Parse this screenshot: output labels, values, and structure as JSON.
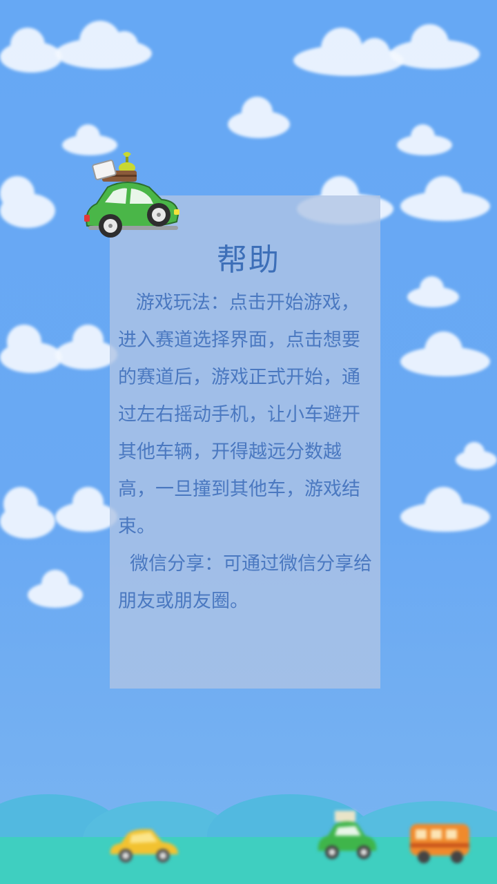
{
  "help": {
    "title": "帮助",
    "paragraph1": "   游戏玩法：点击开始游戏，进入赛道选择界面，点击想要的赛道后，游戏正式开始，通过左右摇动手机，让小车避开其他车辆，开得越远分数越高，一旦撞到其他车，游戏结束。",
    "paragraph2": "  微信分享：可通过微信分享给朋友或朋友圈。"
  },
  "colors": {
    "sky": "#66a8f4",
    "panel": "#b0c4e4",
    "text": "#4a78c0",
    "title": "#3d6fb8",
    "ground": "#3fcfc0"
  },
  "icons": {
    "main_car": "green-car-with-luggage-icon",
    "yellow_car": "yellow-car-icon",
    "green_car": "green-car-icon",
    "bus": "orange-bus-icon"
  }
}
